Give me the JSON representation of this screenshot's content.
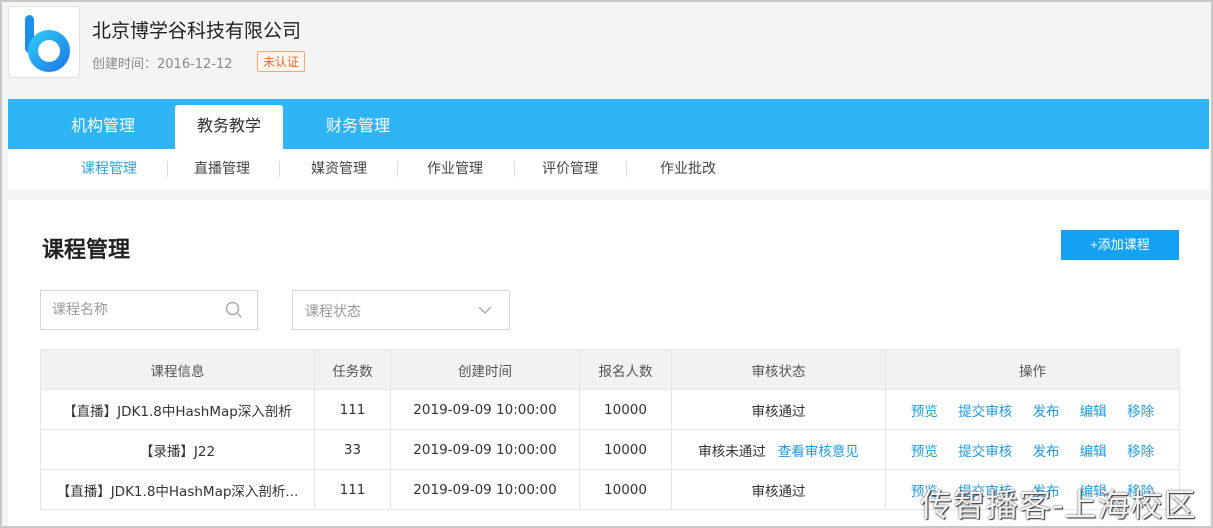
{
  "org": {
    "name": "北京博学谷科技有限公司",
    "created_label": "创建时间：",
    "created_date": "2016-12-12",
    "badge": "未认证"
  },
  "top_nav": {
    "tabs": [
      {
        "label": "机构管理"
      },
      {
        "label": "教务教学"
      },
      {
        "label": "财务管理"
      }
    ],
    "active": "教务教学"
  },
  "sub_nav": {
    "items": [
      {
        "label": "课程管理"
      },
      {
        "label": "直播管理"
      },
      {
        "label": "媒资管理"
      },
      {
        "label": "作业管理"
      },
      {
        "label": "评价管理"
      },
      {
        "label": "作业批改"
      }
    ],
    "active": "课程管理"
  },
  "main": {
    "title": "课程管理",
    "add_button": "+添加课程",
    "search_placeholder": "课程名称",
    "status_placeholder": "课程状态"
  },
  "table": {
    "headers": [
      "课程信息",
      "任务数",
      "创建时间",
      "报名人数",
      "审核状态",
      "操作"
    ],
    "rows": [
      {
        "info": "【直播】JDK1.8中HashMap深入剖析",
        "tasks": "111",
        "created": "2019-09-09 10:00:00",
        "enrolled": "10000",
        "status": "审核通过",
        "status_link": ""
      },
      {
        "info": "【录播】J22",
        "tasks": "33",
        "created": "2019-09-09 10:00:00",
        "enrolled": "10000",
        "status": "审核未通过",
        "status_link": "查看审核意见"
      },
      {
        "info": "【直播】JDK1.8中HashMap深入剖析...",
        "tasks": "111",
        "created": "2019-09-09 10:00:00",
        "enrolled": "10000",
        "status": "审核通过",
        "status_link": ""
      }
    ],
    "actions": [
      "预览",
      "提交审核",
      "发布",
      "编辑",
      "移除"
    ]
  },
  "watermark": "传智播客-上海校区",
  "colors": {
    "nav_blue": "#2fb4f5",
    "link_blue": "#1d9be8",
    "button_blue": "#14a3f4",
    "badge_orange": "#f36b2b"
  }
}
